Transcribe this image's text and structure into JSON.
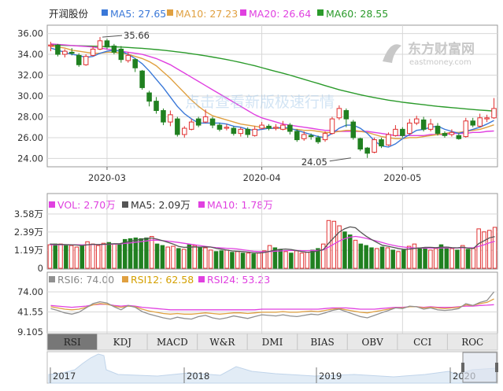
{
  "header": {
    "stock_name": "开润股份",
    "ma_labels": [
      {
        "text": "MA5: 27.65",
        "color": "#3a78d8"
      },
      {
        "text": "MA10: 27.23",
        "color": "#e0a040"
      },
      {
        "text": "MA20: 26.64",
        "color": "#e040e0"
      },
      {
        "text": "MA60: 28.55",
        "color": "#2a9a2a"
      }
    ]
  },
  "watermark": {
    "logo_text": "东方财富网",
    "logo_sub": "eastmoney.com",
    "center_text": "点击查看新版极速行情"
  },
  "colors": {
    "up": "#e03030",
    "down": "#208020",
    "grid": "#d7d7d7",
    "panel_border": "#999999"
  },
  "volume_header": {
    "vol": "VOL: 2.70万",
    "ma5": "MA5: 2.09万",
    "ma10": "MA10: 1.78万"
  },
  "rsi_header": {
    "rsi6": "RSI6: 74.00",
    "rsi12": "RSI12: 62.58",
    "rsi24": "RSI24: 53.23"
  },
  "tabs": [
    "RSI",
    "KDJ",
    "MACD",
    "W&R",
    "DMI",
    "BIAS",
    "OBV",
    "CCI",
    "ROC"
  ],
  "active_tab": 0,
  "timeline": {
    "years": [
      "2017",
      "2018",
      "2019",
      "2020"
    ]
  },
  "chart_data": [
    {
      "type": "candlestick",
      "title": "",
      "y_ticks": [
        "36.00",
        "34.00",
        "32.00",
        "30.00",
        "28.00",
        "26.00",
        "24.00"
      ],
      "ylim": [
        23.2,
        36.8
      ],
      "x_ticks": [
        {
          "label": "2020-03",
          "index": 8
        },
        {
          "label": "2020-04",
          "index": 30
        },
        {
          "label": "2020-05",
          "index": 50
        }
      ],
      "annotations": [
        {
          "text": "35.66",
          "index": 7,
          "value": 35.66
        },
        {
          "text": "24.05",
          "index": 43,
          "value": 24.05
        }
      ],
      "candles": [
        [
          34.8,
          34.9,
          35.2,
          34.3
        ],
        [
          34.9,
          34.0,
          35.0,
          33.8
        ],
        [
          34.0,
          34.3,
          34.5,
          33.7
        ],
        [
          34.2,
          34.1,
          34.6,
          33.9
        ],
        [
          33.9,
          33.0,
          34.1,
          32.8
        ],
        [
          33.0,
          33.8,
          34.0,
          32.9
        ],
        [
          33.9,
          34.5,
          34.8,
          33.8
        ],
        [
          34.5,
          35.3,
          35.66,
          34.4
        ],
        [
          35.3,
          34.7,
          35.5,
          34.5
        ],
        [
          34.8,
          34.2,
          35.0,
          34.0
        ],
        [
          34.5,
          33.5,
          34.8,
          33.2
        ],
        [
          33.4,
          33.9,
          34.2,
          33.2
        ],
        [
          33.5,
          32.7,
          33.6,
          32.3
        ],
        [
          32.4,
          30.8,
          32.5,
          30.6
        ],
        [
          30.3,
          29.5,
          30.5,
          29.0
        ],
        [
          29.5,
          28.6,
          29.9,
          28.3
        ],
        [
          28.6,
          27.5,
          28.8,
          27.2
        ],
        [
          27.5,
          28.2,
          28.6,
          27.1
        ],
        [
          27.8,
          26.3,
          28.0,
          26.1
        ],
        [
          26.3,
          26.9,
          27.1,
          26.0
        ],
        [
          26.8,
          27.5,
          27.8,
          26.7
        ],
        [
          27.8,
          27.2,
          28.0,
          27.0
        ],
        [
          27.5,
          28.0,
          28.7,
          27.4
        ],
        [
          27.8,
          27.2,
          28.0,
          26.9
        ],
        [
          27.2,
          26.8,
          27.4,
          26.6
        ],
        [
          26.9,
          27.0,
          27.3,
          26.7
        ],
        [
          26.9,
          26.4,
          27.1,
          26.2
        ],
        [
          26.4,
          26.8,
          27.0,
          26.1
        ],
        [
          26.8,
          26.3,
          27.0,
          26.0
        ],
        [
          26.2,
          26.8,
          27.1,
          26.1
        ],
        [
          26.9,
          27.2,
          27.5,
          26.8
        ],
        [
          27.1,
          26.9,
          27.3,
          26.7
        ],
        [
          26.9,
          27.0,
          27.3,
          26.7
        ],
        [
          26.8,
          27.2,
          27.6,
          26.7
        ],
        [
          27.2,
          26.6,
          27.4,
          26.3
        ],
        [
          26.6,
          25.8,
          26.8,
          25.6
        ],
        [
          25.9,
          26.3,
          26.6,
          25.7
        ],
        [
          26.2,
          26.1,
          26.4,
          25.8
        ],
        [
          26.0,
          25.6,
          26.2,
          25.4
        ],
        [
          25.8,
          26.4,
          26.6,
          25.6
        ],
        [
          26.4,
          27.8,
          28.0,
          26.3
        ],
        [
          27.9,
          28.8,
          29.1,
          27.7
        ],
        [
          28.6,
          27.8,
          28.8,
          27.0
        ],
        [
          27.5,
          26.0,
          27.7,
          25.8
        ],
        [
          25.9,
          24.9,
          26.0,
          24.7
        ],
        [
          25.0,
          24.5,
          25.1,
          24.05
        ],
        [
          24.6,
          25.8,
          26.0,
          24.5
        ],
        [
          25.8,
          25.2,
          26.0,
          25.0
        ],
        [
          25.3,
          26.3,
          26.5,
          25.2
        ],
        [
          26.2,
          26.8,
          27.2,
          26.1
        ],
        [
          26.8,
          26.2,
          27.0,
          26.0
        ],
        [
          26.4,
          27.4,
          27.8,
          26.3
        ],
        [
          27.4,
          27.8,
          28.1,
          27.2
        ],
        [
          27.7,
          26.8,
          28.0,
          26.6
        ],
        [
          26.8,
          27.3,
          27.8,
          26.6
        ],
        [
          27.1,
          26.4,
          27.4,
          26.2
        ],
        [
          26.4,
          26.2,
          26.6,
          26.0
        ],
        [
          26.3,
          26.5,
          26.8,
          26.1
        ],
        [
          26.2,
          25.9,
          26.4,
          25.8
        ],
        [
          26.1,
          27.6,
          27.9,
          26.0
        ],
        [
          27.6,
          27.2,
          27.9,
          27.0
        ],
        [
          27.1,
          27.9,
          28.3,
          27.0
        ],
        [
          27.8,
          27.9,
          28.2,
          27.5
        ],
        [
          27.9,
          28.8,
          29.8,
          27.8
        ]
      ],
      "ma5": [
        34.6,
        34.4,
        34.2,
        34.0,
        33.9,
        33.7,
        33.8,
        34.1,
        34.3,
        34.4,
        34.3,
        34.0,
        33.6,
        33.1,
        32.4,
        31.6,
        30.8,
        29.9,
        29.0,
        28.3,
        27.8,
        27.4,
        27.4,
        27.4,
        27.4,
        27.3,
        27.1,
        27.0,
        26.8,
        26.7,
        26.8,
        26.9,
        26.9,
        27.0,
        26.9,
        26.7,
        26.5,
        26.3,
        26.1,
        26.0,
        26.4,
        26.9,
        27.2,
        27.2,
        26.9,
        26.4,
        25.7,
        25.2,
        25.1,
        25.4,
        25.9,
        26.3,
        26.7,
        26.8,
        27.0,
        27.1,
        26.8,
        26.6,
        26.4,
        26.6,
        26.8,
        27.0,
        27.3,
        27.65
      ],
      "ma10": [
        34.8,
        34.7,
        34.6,
        34.4,
        34.3,
        34.2,
        34.1,
        34.1,
        34.2,
        34.2,
        34.1,
        34.0,
        33.8,
        33.6,
        33.3,
        32.9,
        32.3,
        31.7,
        31.0,
        30.3,
        29.6,
        29.0,
        28.5,
        28.1,
        27.9,
        27.7,
        27.5,
        27.3,
        27.2,
        27.1,
        27.0,
        26.9,
        26.9,
        26.9,
        26.8,
        26.8,
        26.7,
        26.7,
        26.6,
        26.5,
        26.5,
        26.6,
        26.7,
        26.7,
        26.6,
        26.5,
        26.3,
        26.1,
        26.0,
        25.9,
        25.9,
        26.0,
        26.0,
        26.1,
        26.2,
        26.3,
        26.4,
        26.5,
        26.5,
        26.6,
        26.7,
        26.8,
        27.0,
        27.23
      ],
      "ma20": [
        35.0,
        34.95,
        34.9,
        34.85,
        34.8,
        34.75,
        34.7,
        34.6,
        34.5,
        34.4,
        34.3,
        34.2,
        34.1,
        34.0,
        33.8,
        33.6,
        33.3,
        33.0,
        32.6,
        32.2,
        31.8,
        31.4,
        31.0,
        30.6,
        30.2,
        29.8,
        29.4,
        29.0,
        28.6,
        28.2,
        27.9,
        27.7,
        27.5,
        27.3,
        27.2,
        27.1,
        27.0,
        26.9,
        26.8,
        26.7,
        26.7,
        26.6,
        26.6,
        26.6,
        26.6,
        26.6,
        26.5,
        26.4,
        26.3,
        26.2,
        26.2,
        26.2,
        26.2,
        26.2,
        26.3,
        26.3,
        26.3,
        26.4,
        26.4,
        26.4,
        26.5,
        26.5,
        26.6,
        26.64
      ],
      "ma60": [
        34.9,
        34.88,
        34.86,
        34.84,
        34.82,
        34.8,
        34.78,
        34.76,
        34.74,
        34.72,
        34.7,
        34.66,
        34.62,
        34.58,
        34.52,
        34.46,
        34.4,
        34.32,
        34.24,
        34.16,
        34.06,
        33.96,
        33.86,
        33.74,
        33.62,
        33.5,
        33.36,
        33.22,
        33.06,
        32.9,
        32.72,
        32.54,
        32.36,
        32.18,
        32.0,
        31.8,
        31.6,
        31.4,
        31.2,
        31.0,
        30.8,
        30.6,
        30.44,
        30.28,
        30.12,
        29.98,
        29.84,
        29.72,
        29.6,
        29.5,
        29.4,
        29.32,
        29.24,
        29.16,
        29.08,
        29.0,
        28.94,
        28.88,
        28.82,
        28.76,
        28.7,
        28.65,
        28.6,
        28.55
      ]
    },
    {
      "type": "bar",
      "title": "",
      "y_ticks": [
        "3.58万",
        "2.39万",
        "1.19万",
        "0"
      ],
      "ylim": [
        0,
        3.58
      ],
      "values": [
        1.55,
        1.6,
        1.6,
        1.5,
        1.5,
        1.4,
        1.45,
        1.75,
        1.6,
        1.5,
        1.65,
        1.7,
        1.6,
        1.6,
        1.9,
        1.95,
        2.0,
        1.95,
        2.0,
        2.1,
        1.6,
        1.5,
        1.4,
        1.45,
        1.3,
        1.25,
        1.55,
        1.5,
        1.4,
        1.35,
        1.2,
        1.1,
        1.15,
        1.2,
        1.05,
        1.1,
        1.0,
        1.0,
        0.95,
        1.0,
        1.15,
        1.5,
        1.35,
        1.25,
        1.1,
        1.0,
        1.15,
        1.0,
        1.05,
        1.2,
        1.3,
        1.6,
        3.15,
        3.1,
        2.8,
        2.4,
        2.2,
        1.85,
        1.6,
        1.5,
        1.35,
        1.3,
        1.4,
        1.35,
        1.2,
        1.1,
        1.2,
        1.45,
        1.6,
        1.35,
        1.3,
        1.2,
        1.3,
        1.55,
        1.4,
        1.3,
        1.2,
        1.5,
        1.25,
        1.3,
        2.6,
        2.4,
        2.5,
        2.7
      ],
      "up": [
        1,
        0,
        1,
        0,
        1,
        1,
        0,
        1,
        1,
        1,
        1,
        0,
        1,
        0,
        0,
        0,
        0,
        0,
        0,
        1,
        0,
        0,
        1,
        1,
        0,
        1,
        0,
        1,
        0,
        1,
        1,
        0,
        0,
        1,
        0,
        1,
        0,
        1,
        0,
        1,
        1,
        1,
        0,
        0,
        1,
        0,
        1,
        1,
        1,
        0,
        0,
        1,
        1,
        1,
        1,
        0,
        0,
        1,
        0,
        0,
        0,
        1,
        0,
        1,
        0,
        1,
        0,
        1,
        1,
        0,
        0,
        1,
        1,
        0,
        0,
        1,
        0,
        1,
        0,
        1,
        1,
        1,
        1,
        1
      ],
      "ma5": [
        1.6,
        1.58,
        1.57,
        1.56,
        1.55,
        1.53,
        1.5,
        1.55,
        1.58,
        1.56,
        1.58,
        1.6,
        1.62,
        1.62,
        1.7,
        1.78,
        1.85,
        1.9,
        1.96,
        2.0,
        1.92,
        1.82,
        1.71,
        1.6,
        1.45,
        1.38,
        1.39,
        1.41,
        1.4,
        1.41,
        1.4,
        1.32,
        1.26,
        1.2,
        1.14,
        1.12,
        1.1,
        1.07,
        1.02,
        1.01,
        1.04,
        1.12,
        1.19,
        1.25,
        1.27,
        1.24,
        1.17,
        1.1,
        1.06,
        1.08,
        1.14,
        1.23,
        1.65,
        2.03,
        2.39,
        2.61,
        2.73,
        2.67,
        2.37,
        2.11,
        1.9,
        1.7,
        1.52,
        1.46,
        1.38,
        1.31,
        1.25,
        1.26,
        1.31,
        1.34,
        1.38,
        1.38,
        1.36,
        1.39,
        1.4,
        1.36,
        1.35,
        1.39,
        1.33,
        1.31,
        1.63,
        1.81,
        2.01,
        2.09
      ],
      "ma10": [
        1.55,
        1.55,
        1.55,
        1.55,
        1.55,
        1.55,
        1.54,
        1.55,
        1.56,
        1.56,
        1.57,
        1.58,
        1.59,
        1.6,
        1.64,
        1.67,
        1.72,
        1.76,
        1.8,
        1.86,
        1.85,
        1.82,
        1.79,
        1.75,
        1.7,
        1.65,
        1.6,
        1.55,
        1.5,
        1.45,
        1.4,
        1.36,
        1.34,
        1.32,
        1.3,
        1.27,
        1.22,
        1.17,
        1.12,
        1.1,
        1.08,
        1.1,
        1.12,
        1.14,
        1.16,
        1.17,
        1.17,
        1.16,
        1.16,
        1.17,
        1.18,
        1.21,
        1.4,
        1.6,
        1.8,
        1.95,
        2.05,
        2.1,
        2.05,
        1.97,
        1.88,
        1.79,
        1.7,
        1.6,
        1.52,
        1.45,
        1.4,
        1.36,
        1.34,
        1.33,
        1.33,
        1.33,
        1.33,
        1.34,
        1.35,
        1.34,
        1.34,
        1.35,
        1.35,
        1.35,
        1.45,
        1.55,
        1.68,
        1.78
      ]
    },
    {
      "type": "line",
      "title": "",
      "y_ticks": [
        "74.00",
        "41.55",
        "9.105"
      ],
      "ylim": [
        9.105,
        74.0
      ],
      "series": [
        {
          "name": "RSI6",
          "color": "#909090",
          "values": [
            47,
            44,
            40,
            38,
            41,
            48,
            55,
            58,
            56,
            50,
            45,
            52,
            49,
            42,
            38,
            35,
            32,
            30,
            33,
            31,
            30,
            34,
            36,
            32,
            30,
            32,
            35,
            33,
            31,
            34,
            37,
            36,
            35,
            37,
            35,
            34,
            36,
            38,
            37,
            40,
            44,
            46,
            42,
            38,
            34,
            32,
            36,
            40,
            44,
            48,
            47,
            51,
            50,
            46,
            48,
            45,
            44,
            45,
            47,
            55,
            52,
            57,
            60,
            74
          ]
        },
        {
          "name": "RSI12",
          "color": "#e0a040",
          "values": [
            50,
            48,
            46,
            45,
            46,
            49,
            53,
            55,
            54,
            51,
            49,
            51,
            50,
            46,
            43,
            41,
            39,
            38,
            39,
            38,
            38,
            39,
            40,
            39,
            38,
            39,
            40,
            40,
            39,
            40,
            41,
            41,
            41,
            42,
            41,
            41,
            42,
            43,
            42,
            44,
            46,
            47,
            45,
            43,
            41,
            40,
            42,
            44,
            46,
            48,
            48,
            50,
            50,
            48,
            49,
            48,
            47,
            48,
            49,
            53,
            52,
            55,
            57,
            62.58
          ]
        },
        {
          "name": "RSI24",
          "color": "#e040e0",
          "values": [
            52,
            51,
            50,
            49,
            50,
            51,
            53,
            54,
            54,
            52,
            51,
            52,
            51,
            49,
            48,
            47,
            46,
            45,
            45,
            45,
            45,
            45,
            45,
            45,
            45,
            45,
            45,
            45,
            45,
            45,
            46,
            46,
            46,
            46,
            46,
            46,
            46,
            46,
            46,
            47,
            48,
            48,
            48,
            47,
            46,
            46,
            46,
            47,
            48,
            49,
            49,
            50,
            50,
            49,
            50,
            49,
            49,
            49,
            50,
            51,
            51,
            52,
            52.5,
            53.23
          ]
        }
      ]
    }
  ]
}
